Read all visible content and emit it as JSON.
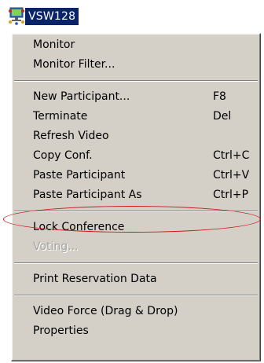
{
  "node": {
    "label": "VSW128",
    "icon": "network-node-icon"
  },
  "menu": {
    "groups": [
      [
        {
          "label": "Monitor",
          "shortcut": "",
          "enabled": true
        },
        {
          "label": "Monitor Filter...",
          "shortcut": "",
          "enabled": true
        }
      ],
      [
        {
          "label": "New Participant...",
          "shortcut": "F8",
          "enabled": true
        },
        {
          "label": "Terminate",
          "shortcut": "Del",
          "enabled": true
        },
        {
          "label": "Refresh Video",
          "shortcut": "",
          "enabled": true
        },
        {
          "label": "Copy Conf.",
          "shortcut": "Ctrl+C",
          "enabled": true
        },
        {
          "label": "Paste Participant",
          "shortcut": "Ctrl+V",
          "enabled": true
        },
        {
          "label": "Paste Participant As",
          "shortcut": "Ctrl+P",
          "enabled": true
        }
      ],
      [
        {
          "label": "Lock Conference",
          "shortcut": "",
          "enabled": true,
          "highlighted": true
        },
        {
          "label": "Voting...",
          "shortcut": "",
          "enabled": false
        }
      ],
      [
        {
          "label": "Print Reservation Data",
          "shortcut": "",
          "enabled": true
        }
      ],
      [
        {
          "label": "Video Force (Drag & Drop)",
          "shortcut": "",
          "enabled": true
        },
        {
          "label": "Properties",
          "shortcut": "",
          "enabled": true
        }
      ]
    ]
  },
  "colors": {
    "menu_bg": "#d4d0c8",
    "selection": "#0a246a",
    "highlight_ellipse": "#cc1a1a",
    "disabled_text": "#a6a49f"
  }
}
